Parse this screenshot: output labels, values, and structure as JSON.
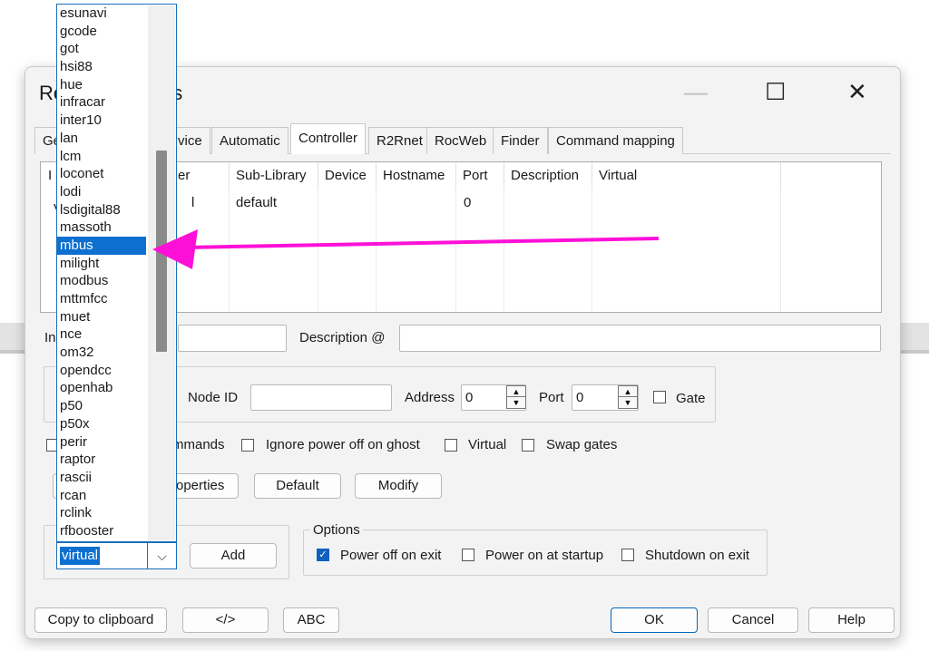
{
  "window": {
    "title_visible": "Ro",
    "title_tail": "ies",
    "minimize_glyph": "—",
    "maximize_glyph": "☐",
    "close_glyph": "✕"
  },
  "tabs": [
    {
      "label": "Ge"
    },
    {
      "label": "vice"
    },
    {
      "label": "Automatic"
    },
    {
      "label": "Controller"
    },
    {
      "label": "R2Rnet"
    },
    {
      "label": "RocWeb"
    },
    {
      "label": "Finder"
    },
    {
      "label": "Command mapping"
    }
  ],
  "grid": {
    "headers": [
      "I",
      "oller",
      "Sub-Library",
      "Device",
      "Hostname",
      "Port",
      "Description",
      "Virtual"
    ],
    "row": {
      "c0": "V",
      "c1": "l",
      "sublib": "default",
      "port": "0"
    }
  },
  "form": {
    "in_label": "In",
    "description_label": "Description @",
    "description_value": "",
    "node_id_label": "Node ID",
    "node_id_value": "",
    "address_label": "Address",
    "address_value": "0",
    "port_label": "Port",
    "port_value": "0",
    "gate_label": "Gate",
    "mmands_label": "mmands",
    "ignore_power_label": "Ignore power off on ghost",
    "virtual_label": "Virtual",
    "swap_gates_label": "Swap gates",
    "properties_button": "operties",
    "default_button": "Default",
    "modify_button": "Modify",
    "add_button": "Add",
    "options_label": "Options",
    "power_off_exit_label": "Power off on exit",
    "power_on_startup_label": "Power on at startup",
    "shutdown_exit_label": "Shutdown on exit"
  },
  "footer": {
    "copy_button": "Copy to clipboard",
    "xml_button": "</>",
    "abc_button": "ABC",
    "ok_button": "OK",
    "cancel_button": "Cancel",
    "help_button": "Help"
  },
  "dropdown": {
    "items": [
      "esunavi",
      "gcode",
      "got",
      "hsi88",
      "hue",
      "infracar",
      "inter10",
      "lan",
      "lcm",
      "loconet",
      "lodi",
      "lsdigital88",
      "massoth",
      "mbus",
      "milight",
      "modbus",
      "mttmfcc",
      "muet",
      "nce",
      "om32",
      "opendcc",
      "openhab",
      "p50",
      "p50x",
      "perir",
      "raptor",
      "rascii",
      "rcan",
      "rclink",
      "rfbooster"
    ],
    "selected": "mbus",
    "combo_value": "virtual",
    "combo_arrow": "⌵"
  },
  "annotation": {
    "color": "#ff10d8"
  },
  "colors": {
    "accent": "#0d6fcf",
    "checkbox_checked": "#1060c0"
  }
}
